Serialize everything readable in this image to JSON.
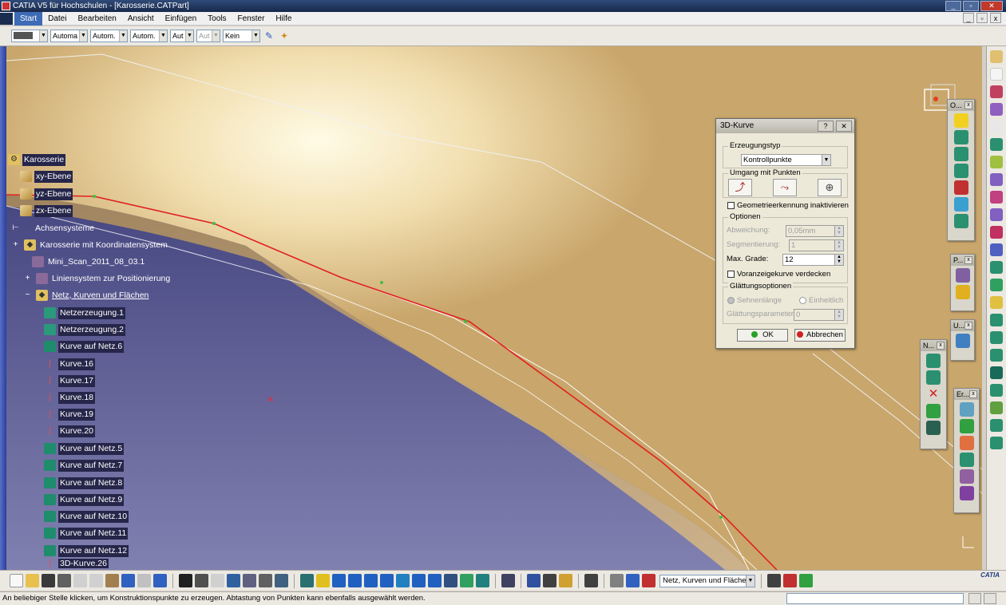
{
  "window": {
    "title": "CATIA V5 für Hochschulen - [Karosserie.CATPart]",
    "min": "_",
    "restore": "▫",
    "close": "✕"
  },
  "menu": {
    "items": [
      "Start",
      "Datei",
      "Bearbeiten",
      "Ansicht",
      "Einfügen",
      "Tools",
      "Fenster",
      "Hilfe"
    ],
    "mdi": {
      "min": "_",
      "restore": "▫",
      "close": "x"
    }
  },
  "format_toolbar": {
    "combos": [
      "Automa",
      "Autom.",
      "Autom.",
      "Aut",
      "Aut",
      "Kein"
    ]
  },
  "tree": {
    "nodes": [
      {
        "label": "Karosserie",
        "icon": "part-icon"
      },
      {
        "label": "xy-Ebene",
        "icon": "plane-icon"
      },
      {
        "label": "yz-Ebene",
        "icon": "plane-icon"
      },
      {
        "label": "zx-Ebene",
        "icon": "plane-icon"
      },
      {
        "label": "Achsensysteme",
        "icon": "axis-system-icon"
      },
      {
        "label": "Karosserie mit Koordinatensystem",
        "icon": "geometrical-set-icon"
      },
      {
        "label": "Mini_Scan_2011_08_03.1",
        "icon": "cloud-scan-icon"
      },
      {
        "label": "Liniensystem zur Positionierung",
        "icon": "geometrical-set-icon"
      },
      {
        "label": "Netz, Kurven und Flächen",
        "icon": "geometrical-set-icon"
      },
      {
        "label": "Netzerzeugung.1",
        "icon": "mesh-icon"
      },
      {
        "label": "Netzerzeugung.2",
        "icon": "mesh-icon"
      },
      {
        "label": "Kurve auf Netz.6",
        "icon": "curve-on-mesh-icon"
      },
      {
        "label": "Kurve.16",
        "icon": "curve-icon"
      },
      {
        "label": "Kurve.17",
        "icon": "curve-icon"
      },
      {
        "label": "Kurve.18",
        "icon": "curve-icon"
      },
      {
        "label": "Kurve.19",
        "icon": "curve-icon"
      },
      {
        "label": "Kurve.20",
        "icon": "curve-icon"
      },
      {
        "label": "Kurve auf Netz.5",
        "icon": "curve-on-mesh-icon"
      },
      {
        "label": "Kurve auf Netz.7",
        "icon": "curve-on-mesh-icon"
      },
      {
        "label": "Kurve auf Netz.8",
        "icon": "curve-on-mesh-icon"
      },
      {
        "label": "Kurve auf Netz.9",
        "icon": "curve-on-mesh-icon"
      },
      {
        "label": "Kurve auf Netz.10",
        "icon": "curve-on-mesh-icon"
      },
      {
        "label": "Kurve auf Netz.11",
        "icon": "curve-on-mesh-icon"
      },
      {
        "label": "Kurve auf Netz.12",
        "icon": "curve-on-mesh-icon"
      },
      {
        "label": "3D-Kurve.26",
        "icon": "3d-curve-icon"
      }
    ]
  },
  "dialog": {
    "title": "3D-Kurve",
    "help": "?",
    "close": "✕",
    "creation_type_group": "Erzeugungstyp",
    "creation_type_value": "Kontrollpunkte",
    "points_group": "Umgang mit Punkten",
    "geom_detect_label": "Geometrieerkennung inaktivieren",
    "options_group": "Optionen",
    "deviation_label": "Abweichung:",
    "deviation_value": "0,05mm",
    "segmentation_label": "Segmentierung:",
    "segmentation_value": "1",
    "max_degree_label": "Max. Grade:",
    "max_degree_value": "12",
    "hide_preview_label": "Voranzeigekurve verdecken",
    "smoothing_group": "Glättungsoptionen",
    "chord_label": "Sehnenlänge",
    "uniform_label": "Einheitlich",
    "smoothing_param_label": "Glättungsparameter",
    "smoothing_param_value": "0",
    "ok": "OK",
    "cancel": "Abbrechen"
  },
  "float_toolbars": [
    {
      "title": "O..."
    },
    {
      "title": "P..."
    },
    {
      "title": "U..."
    },
    {
      "title": "N..."
    },
    {
      "title": "Er..."
    }
  ],
  "bottom_toolbar": {
    "workbench": "Netz, Kurven und Flächen"
  },
  "brand": "CATIA",
  "status": {
    "message": "An beliebiger Stelle klicken, um Konstruktionspunkte zu erzeugen. Abtastung von Punkten kann ebenfalls ausgewählt werden."
  },
  "colors": {
    "accent": "#3d6bb5",
    "surface": "#c9a66b",
    "background": "#3a3a78",
    "curve": "#e02020"
  }
}
